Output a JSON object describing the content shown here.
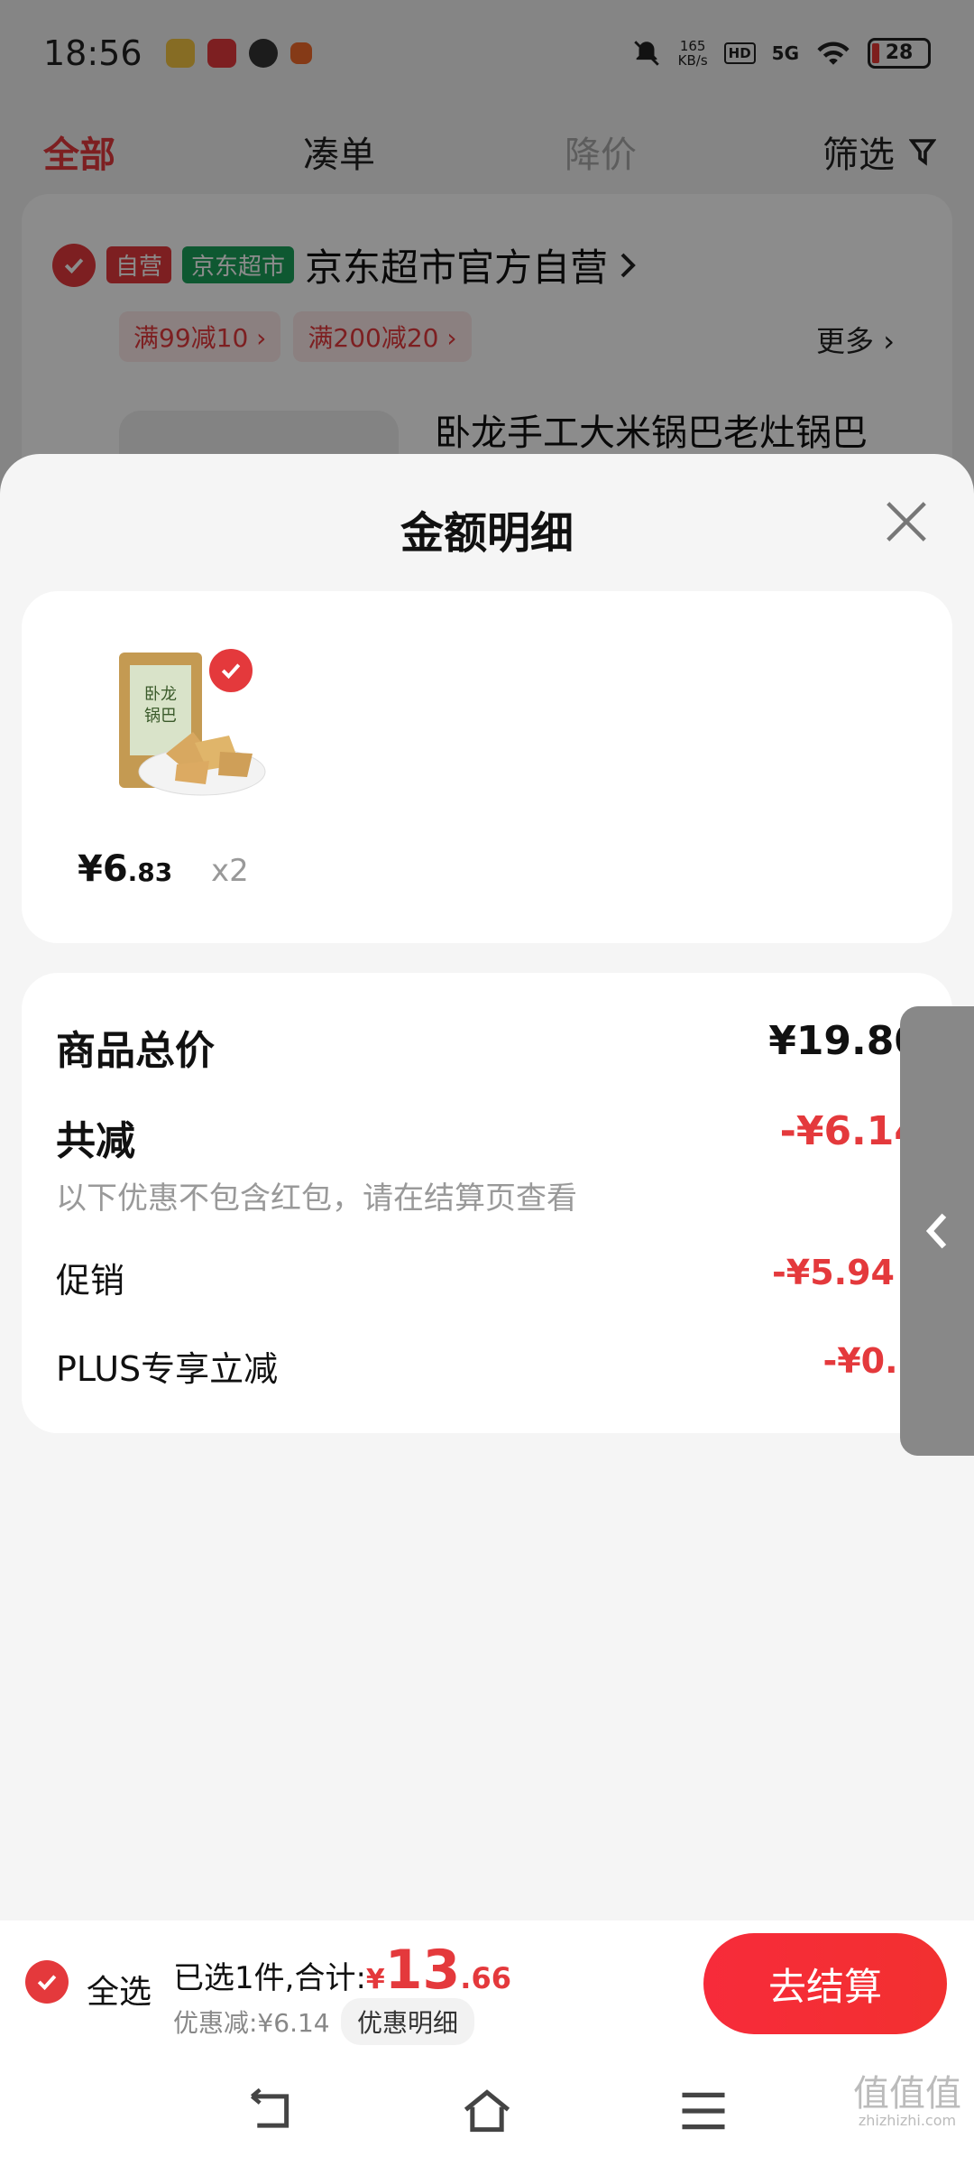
{
  "status_bar": {
    "time": "18:56",
    "net_speed_value": "165",
    "net_speed_unit": "KB/s",
    "hd_label": "HD",
    "signal_label": "5G",
    "battery": "28"
  },
  "tabs": {
    "all": "全部",
    "cou": "凑单",
    "price_drop": "降价",
    "filter": "筛选"
  },
  "store": {
    "tag_self": "自营",
    "tag_jd": "京东超市",
    "name": "京东超市官方自营",
    "coupons": [
      "满99减10",
      "满200减20"
    ],
    "more": "更多",
    "product_title": "卧龙手工大米锅巴老灶锅巴"
  },
  "sheet": {
    "title": "金额明细",
    "item": {
      "price_int": "¥6",
      "price_dec": ".83",
      "qty": "x2"
    },
    "total_label": "商品总价",
    "total_value": "¥19.80",
    "reduce_label": "共减",
    "reduce_value": "-¥6.14",
    "note": "以下优惠不包含红包，请在结算页查看",
    "promo_label": "促销",
    "promo_value": "-¥5.94",
    "plus_label": "PLUS专享立减",
    "plus_value": "-¥0.2"
  },
  "checkout": {
    "select_all": "全选",
    "selected_text": "已选1件,合计:",
    "yen": "¥",
    "amount_int": "13",
    "amount_dec": ".66",
    "saving": "优惠减:¥6.14",
    "detail_chip": "优惠明细",
    "checkout_button": "去结算"
  },
  "watermark": {
    "main": "值值值",
    "sub": "zhizhizhi.com"
  },
  "colors": {
    "accent": "#e4393c",
    "jd_green": "#1aa05a"
  }
}
